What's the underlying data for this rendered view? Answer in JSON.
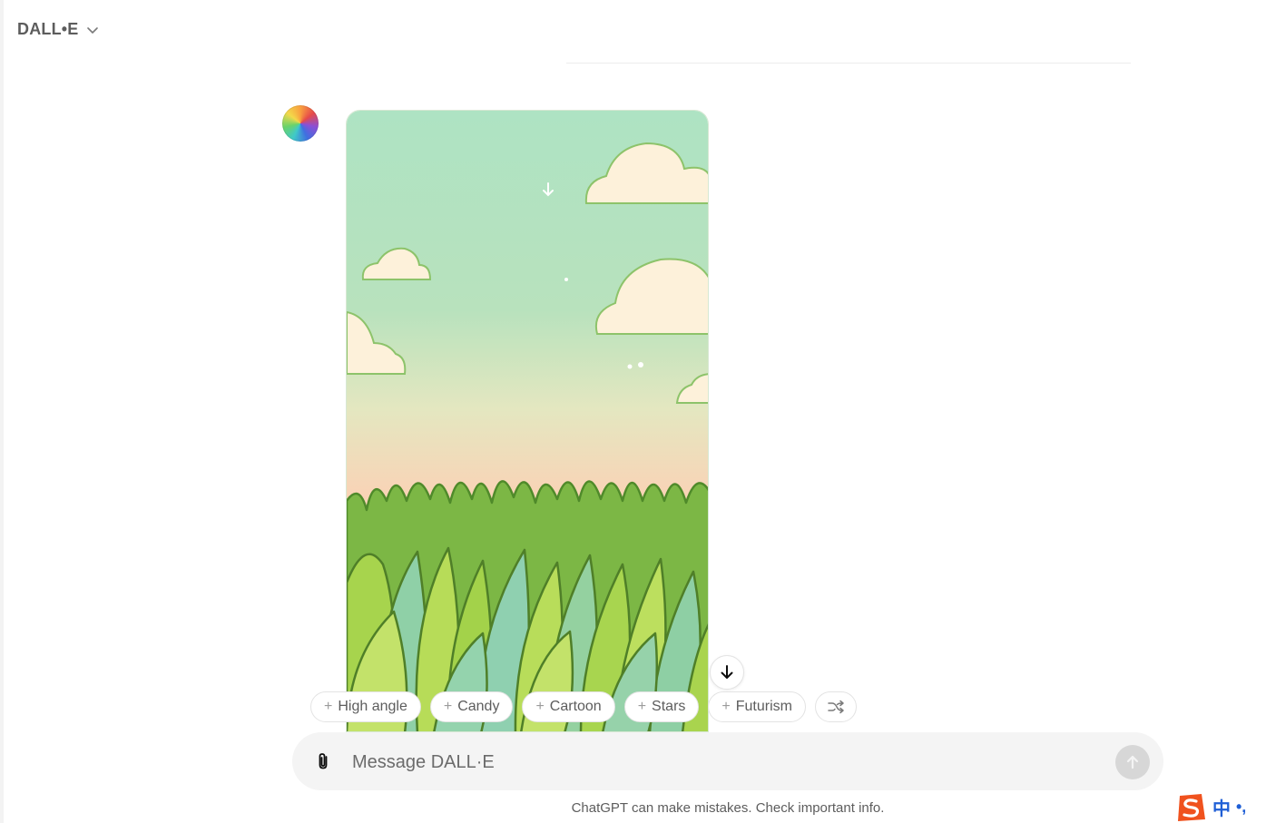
{
  "header": {
    "title": "DALL•E"
  },
  "chips": [
    {
      "label": "High angle"
    },
    {
      "label": "Candy"
    },
    {
      "label": "Cartoon"
    },
    {
      "label": "Stars"
    },
    {
      "label": "Futurism"
    }
  ],
  "composer": {
    "placeholder": "Message DALL·E"
  },
  "footer": {
    "disclaimer": "ChatGPT can make mistakes. Check important info."
  },
  "ime": {
    "language": "中",
    "punctuation": "•,"
  },
  "icons": {
    "header_chevron": "chevron-down-icon",
    "scroll": "arrow-down-icon",
    "shuffle": "shuffle-icon",
    "attach": "paperclip-icon",
    "send": "arrow-up-icon",
    "ime_logo": "sogou-s-logo"
  },
  "colors": {
    "sky_top": "#aee3c3",
    "sky_bottom": "#f9d3b6",
    "grass": "#9ccf45"
  }
}
